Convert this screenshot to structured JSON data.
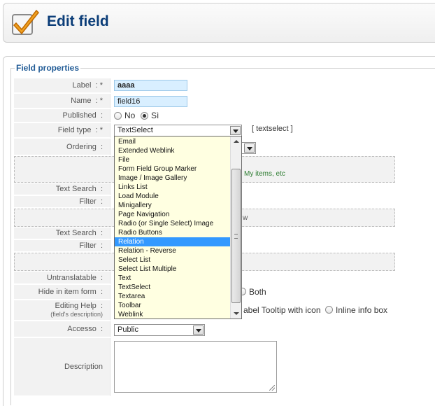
{
  "header": {
    "title": "Edit field"
  },
  "fieldset": {
    "legend": "Field properties"
  },
  "rows": {
    "label": "Label",
    "name": "Name",
    "published": "Published",
    "field_type": "Field type",
    "ordering": "Ordering",
    "text_search": "Text Search",
    "filter": "Filter",
    "text_search_2": "Text Search",
    "filter_2": "Filter",
    "untranslatable": "Untranslatable",
    "hide_in_item_form": "Hide in item form",
    "editing_help": "Editing Help",
    "editing_help_sub": "(field's description)",
    "accesso": "Accesso",
    "description": "Description"
  },
  "sep": ":",
  "required_mark": ": *",
  "values": {
    "label": "aaaa",
    "name": "field16",
    "published_no": "No",
    "published_si": "Sì",
    "field_type_selected": "TextSelect",
    "field_type_code": "[ textselect ]",
    "accesso_selected": "Public"
  },
  "partials": {
    "hint": "My items, etc",
    "w": "w",
    "both": "Both",
    "tooltip_option": "abel Tooltip with icon",
    "inline_option": "Inline info box"
  },
  "dropdown": {
    "items": [
      "Email",
      "Extended Weblink",
      "File",
      "Form Field Group Marker",
      "Image / Image Gallery",
      "Links List",
      "Load Module",
      "Minigallery",
      "Page Navigation",
      "Radio (or Single Select) Image",
      "Radio Buttons",
      "Relation",
      "Relation - Reverse",
      "Select List",
      "Select List Multiple",
      "Text",
      "TextSelect",
      "Textarea",
      "Toolbar",
      "Weblink"
    ],
    "highlighted": "Relation"
  },
  "colors": {
    "title": "#0b3d78",
    "legend": "#215b96",
    "highlight": "#3399ff",
    "dropdown_bg": "#ffffe1",
    "input_bg": "#d9efff"
  },
  "icons": {
    "logo": "checkbox-check-icon"
  }
}
